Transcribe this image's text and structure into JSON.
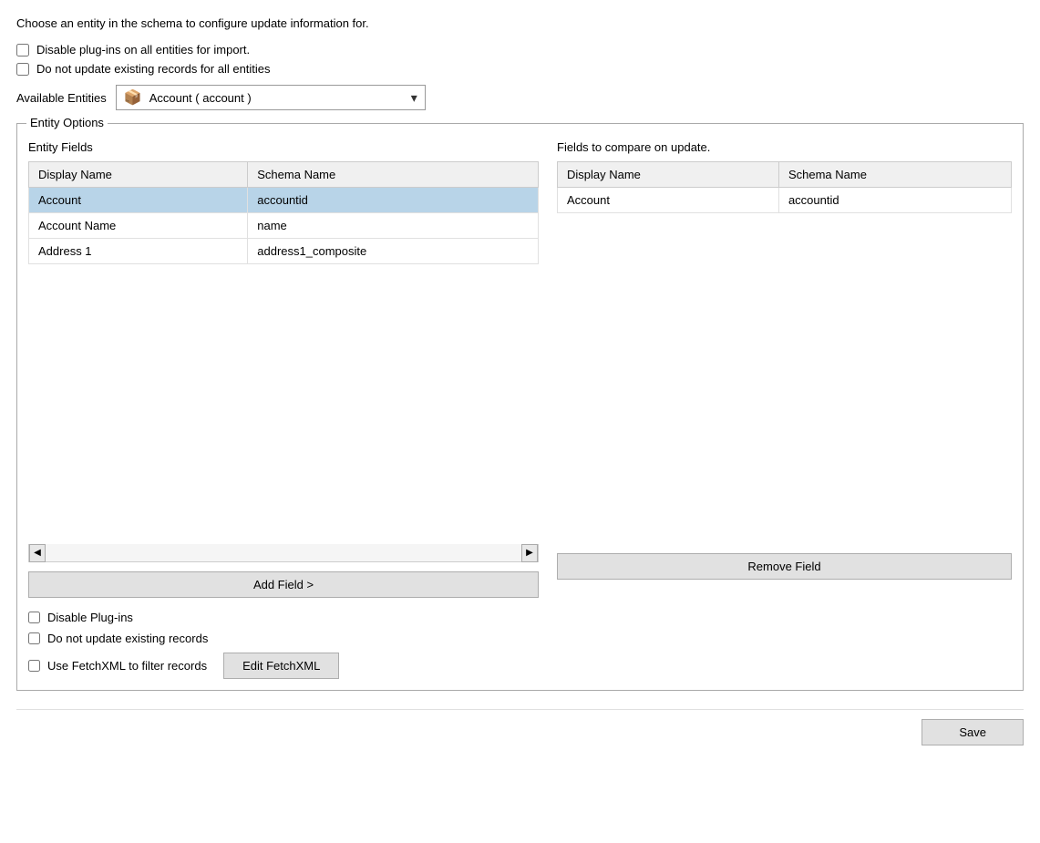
{
  "page": {
    "intro_text": "Choose an entity in the schema to configure update information for.",
    "global_checkboxes": [
      {
        "id": "disable-plugins-all",
        "label": "Disable plug-ins on all entities for import.",
        "checked": false
      },
      {
        "id": "do-not-update-all",
        "label": "Do not update existing records for all entities",
        "checked": false
      }
    ],
    "available_entities_label": "Available Entities",
    "entity_dropdown_value": "Account  ( account )",
    "entity_options_legend": "Entity Options",
    "left_section_label": "Entity Fields",
    "right_section_label": "Fields to compare on update.",
    "left_table": {
      "columns": [
        "Display Name",
        "Schema Name"
      ],
      "rows": [
        {
          "display_name": "Account",
          "schema_name": "accountid",
          "selected": true
        },
        {
          "display_name": "Account Name",
          "schema_name": "name",
          "selected": false
        },
        {
          "display_name": "Address 1",
          "schema_name": "address1_composite",
          "selected": false
        }
      ]
    },
    "right_table": {
      "columns": [
        "Display Name",
        "Schema Name"
      ],
      "rows": [
        {
          "display_name": "Account",
          "schema_name": "accountid"
        }
      ]
    },
    "add_field_button": "Add Field >",
    "remove_field_button": "Remove Field",
    "entity_checkboxes": [
      {
        "id": "disable-plugins",
        "label": "Disable Plug-ins",
        "checked": false
      },
      {
        "id": "do-not-update",
        "label": "Do not update existing records",
        "checked": false
      },
      {
        "id": "use-fetchxml",
        "label": "Use FetchXML to filter records",
        "checked": false
      }
    ],
    "edit_fetchxml_button": "Edit FetchXML",
    "save_button": "Save",
    "icons": {
      "entity_icon": "📦",
      "dropdown_arrow": "▾",
      "scroll_left": "◀",
      "scroll_right": "▶"
    }
  }
}
